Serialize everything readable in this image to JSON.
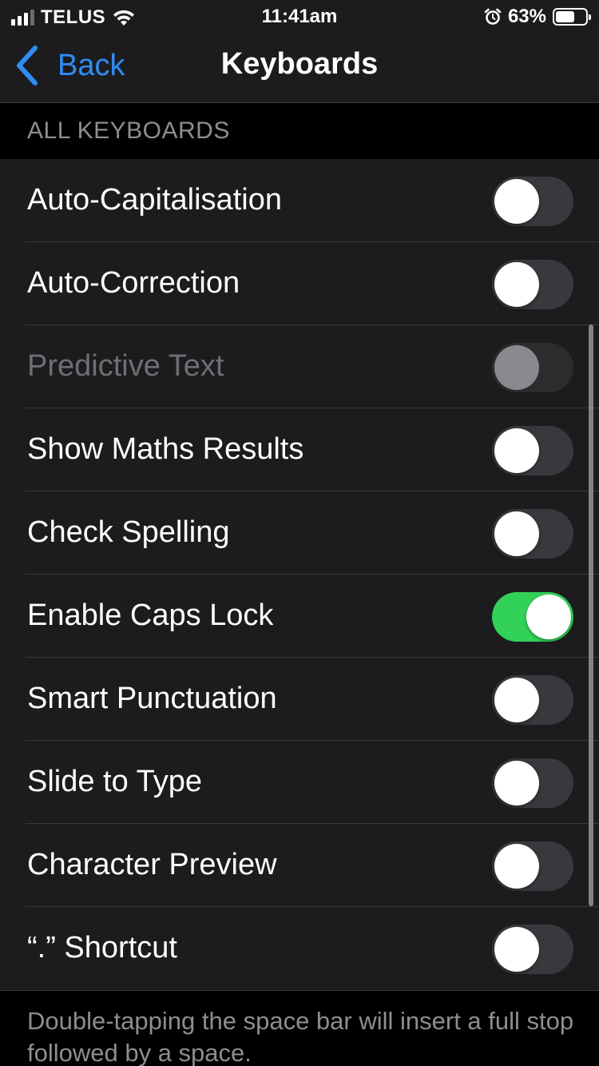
{
  "status_bar": {
    "carrier": "TELUS",
    "time": "11:41am",
    "battery_percent": "63%",
    "battery_level": 0.63,
    "signal_bars_active": 3,
    "icons": [
      "signal-icon",
      "wifi-icon",
      "alarm-icon",
      "battery-icon"
    ]
  },
  "nav": {
    "back_label": "Back",
    "title": "Keyboards",
    "back_icon": "chevron-left-icon"
  },
  "section": {
    "header": "ALL KEYBOARDS"
  },
  "rows": [
    {
      "label": "Auto-Capitalisation",
      "state": "off"
    },
    {
      "label": "Auto-Correction",
      "state": "off"
    },
    {
      "label": "Predictive Text",
      "state": "disabled"
    },
    {
      "label": "Show Maths Results",
      "state": "off"
    },
    {
      "label": "Check Spelling",
      "state": "off"
    },
    {
      "label": "Enable Caps Lock",
      "state": "on"
    },
    {
      "label": "Smart Punctuation",
      "state": "off"
    },
    {
      "label": "Slide to Type",
      "state": "off"
    },
    {
      "label": "Character Preview",
      "state": "off"
    },
    {
      "label": "“.” Shortcut",
      "state": "off"
    }
  ],
  "footer": {
    "note": "Double-tapping the space bar will insert a full stop followed by a space."
  },
  "colors": {
    "accent": "#2f8df5",
    "toggle_on": "#32d158",
    "background": "#1c1c1e"
  }
}
